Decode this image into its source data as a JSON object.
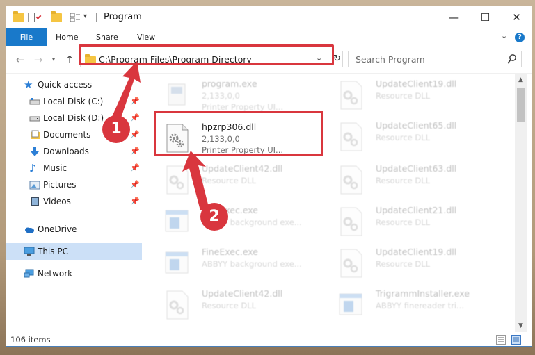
{
  "window": {
    "title": "Program",
    "buttons": {
      "minimize": "—",
      "maximize": "☐",
      "close": "✕"
    }
  },
  "ribbon": {
    "file_tab": "File",
    "tabs": [
      "Home",
      "Share",
      "View"
    ]
  },
  "navigation": {
    "address_path": "C:\\Program Files\\Program Directory",
    "search_placeholder": "Search Program"
  },
  "sidebar": {
    "items": [
      {
        "label": "Quick access",
        "icon": "star-icon",
        "pinned": false
      },
      {
        "label": "Local Disk (C:)",
        "icon": "drive-icon",
        "pinned": true
      },
      {
        "label": "Local Disk (D:)",
        "icon": "drive-icon",
        "pinned": true
      },
      {
        "label": "Documents",
        "icon": "documents-icon",
        "pinned": true
      },
      {
        "label": "Downloads",
        "icon": "download-icon",
        "pinned": true
      },
      {
        "label": "Music",
        "icon": "music-icon",
        "pinned": true
      },
      {
        "label": "Pictures",
        "icon": "pictures-icon",
        "pinned": true
      },
      {
        "label": "Videos",
        "icon": "videos-icon",
        "pinned": true
      },
      {
        "label": "OneDrive",
        "icon": "onedrive-icon",
        "pinned": false
      },
      {
        "label": "This PC",
        "icon": "pc-icon",
        "pinned": false,
        "selected": true
      },
      {
        "label": "Network",
        "icon": "network-icon",
        "pinned": false
      }
    ]
  },
  "files": {
    "left": [
      {
        "name": "program.exe",
        "line1": "2,133,0,0",
        "line2": "Printer Property UI...",
        "icon": "exe-icon"
      },
      {
        "name": "hpzrp306.dll",
        "line1": "2,133,0,0",
        "line2": "Printer Property UI...",
        "icon": "dll-gear-icon"
      },
      {
        "name": "UpdateClient42.dll",
        "line1": "Resource DLL",
        "line2": "",
        "icon": "dll-gear-icon"
      },
      {
        "name": "FineExec.exe",
        "line1": "ABBYY background exe...",
        "line2": "",
        "icon": "exe-window-icon"
      },
      {
        "name": "FineExec.exe",
        "line1": "ABBYY background exe...",
        "line2": "",
        "icon": "exe-window-icon"
      },
      {
        "name": "UpdateClient42.dll",
        "line1": "Resource DLL",
        "line2": "",
        "icon": "dll-gear-icon"
      }
    ],
    "right": [
      {
        "name": "UpdateClient19.dll",
        "line1": "Resource DLL",
        "icon": "dll-gear-icon"
      },
      {
        "name": "UpdateClient65.dll",
        "line1": "Resource DLL",
        "icon": "dll-gear-icon"
      },
      {
        "name": "UpdateClient63.dll",
        "line1": "Resource DLL",
        "icon": "dll-gear-icon"
      },
      {
        "name": "UpdateClient21.dll",
        "line1": "Resource DLL",
        "icon": "dll-gear-icon"
      },
      {
        "name": "UpdateClient19.dll",
        "line1": "Resource DLL",
        "icon": "dll-gear-icon"
      },
      {
        "name": "TrigrammInstaller.exe",
        "line1": "ABBYY finereader tri...",
        "icon": "exe-window-icon"
      }
    ]
  },
  "status": {
    "item_count": "106 items"
  },
  "annotations": {
    "step1": "1",
    "step2": "2",
    "color": "#d9363e"
  }
}
